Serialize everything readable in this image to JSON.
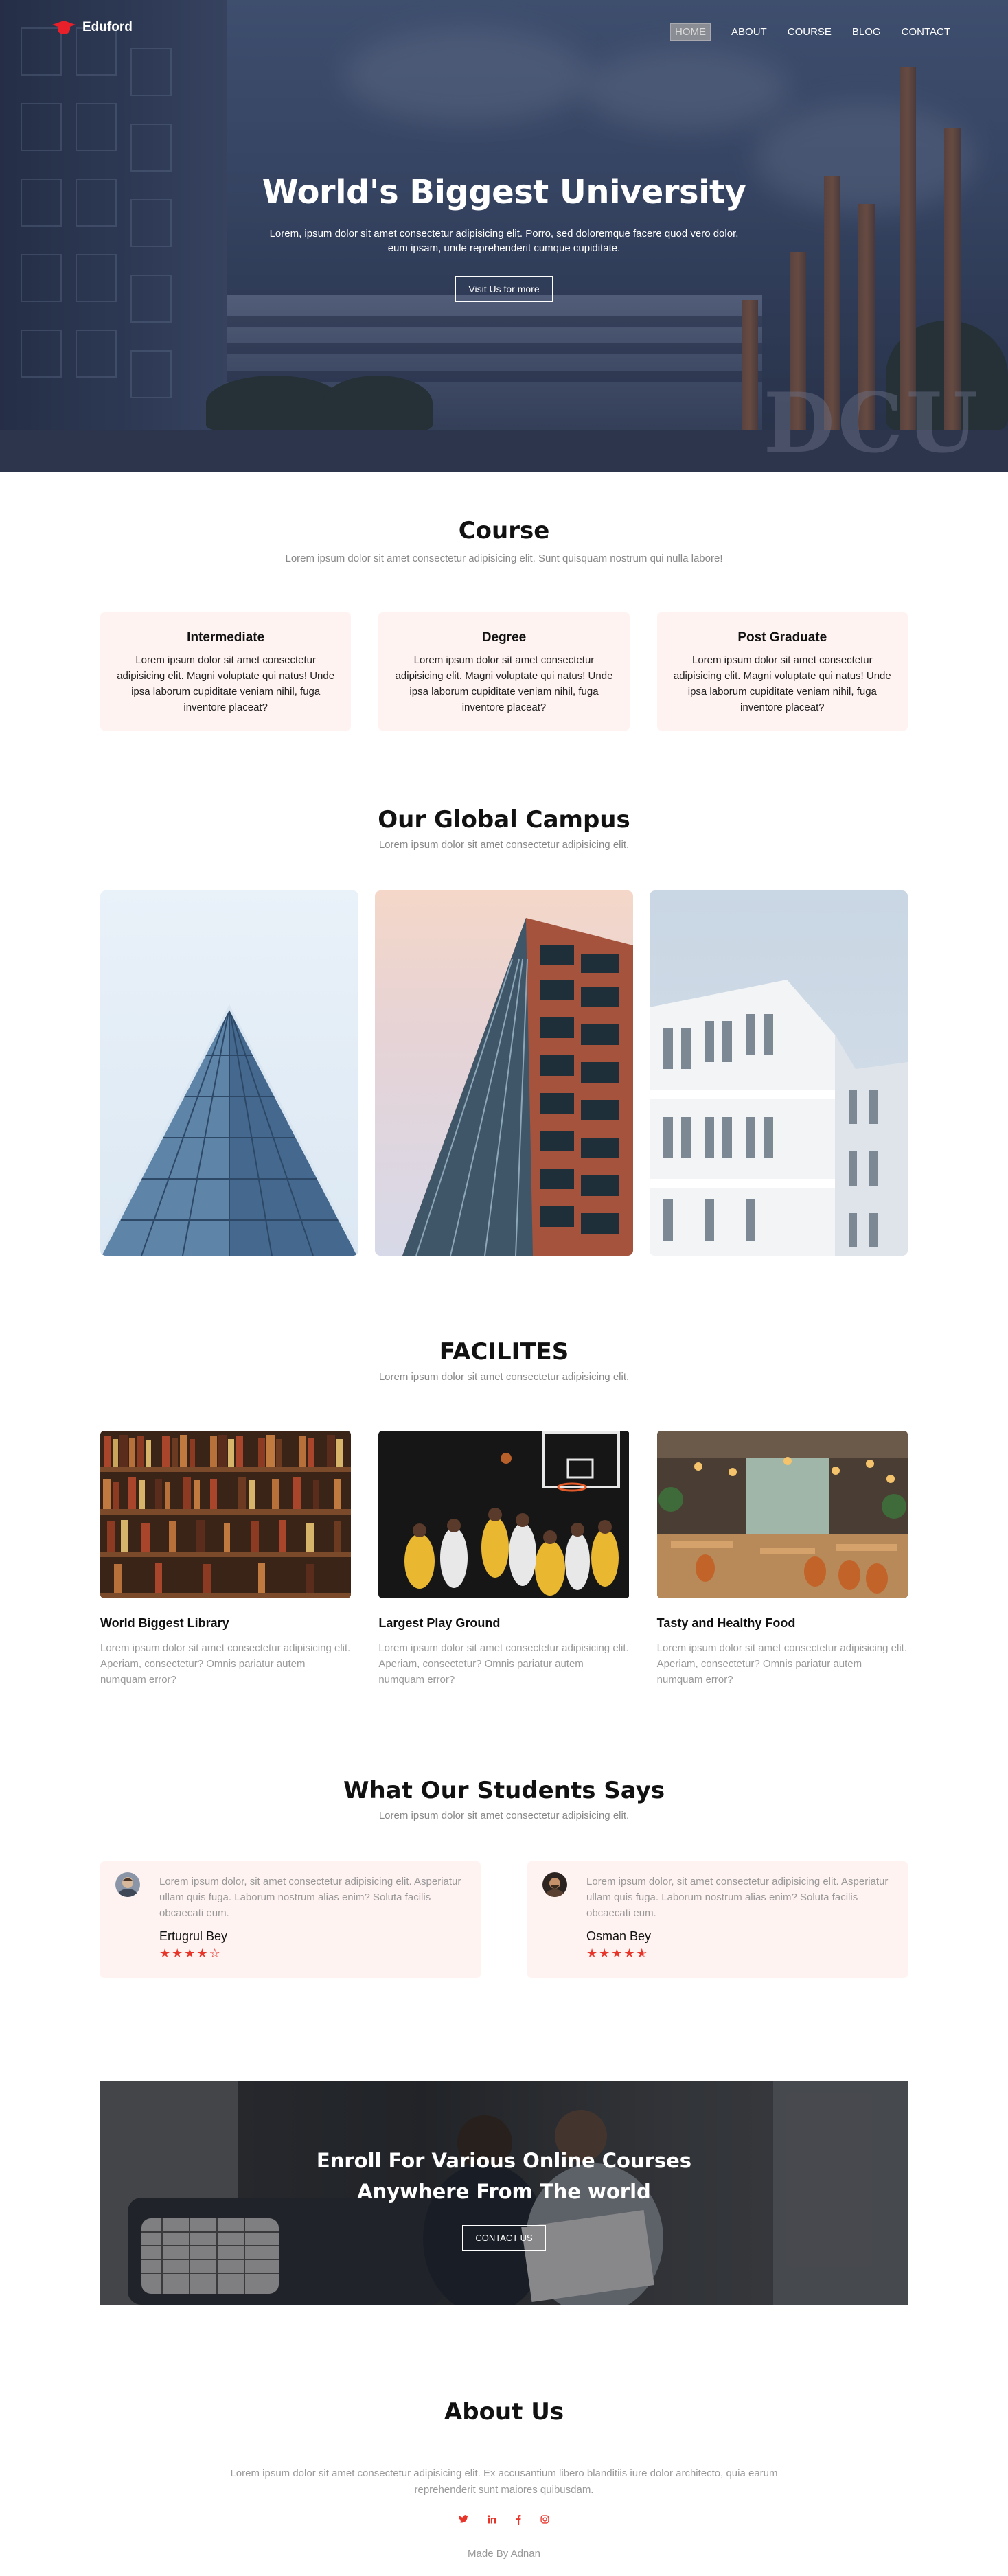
{
  "brand": {
    "name": "Eduford",
    "accent": "#e8202a"
  },
  "nav": {
    "items": [
      {
        "label": "HOME",
        "active": true
      },
      {
        "label": "ABOUT"
      },
      {
        "label": "COURSE"
      },
      {
        "label": "BLOG"
      },
      {
        "label": "CONTACT"
      }
    ]
  },
  "hero": {
    "title": "World's Biggest University",
    "text": "Lorem, ipsum dolor sit amet consectetur adipisicing elit. Porro, sed doloremque facere quod vero dolor, eum ipsam, unde reprehenderit cumque cupiditate.",
    "button": "Visit Us for more",
    "sign": "DCU"
  },
  "course": {
    "title": "Course",
    "subtitle": "Lorem ipsum dolor sit amet consectetur adipisicing elit. Sunt quisquam nostrum qui nulla labore!",
    "cards": [
      {
        "title": "Intermediate",
        "text": "Lorem ipsum dolor sit amet consectetur adipisicing elit. Magni voluptate qui natus! Unde ipsa laborum cupiditate veniam nihil, fuga inventore placeat?"
      },
      {
        "title": "Degree",
        "text": "Lorem ipsum dolor sit amet consectetur adipisicing elit. Magni voluptate qui natus! Unde ipsa laborum cupiditate veniam nihil, fuga inventore placeat?"
      },
      {
        "title": "Post Graduate",
        "text": "Lorem ipsum dolor sit amet consectetur adipisicing elit. Magni voluptate qui natus! Unde ipsa laborum cupiditate veniam nihil, fuga inventore placeat?"
      }
    ]
  },
  "campus": {
    "title": "Our Global Campus",
    "subtitle": "Lorem ipsum dolor sit amet consectetur adipisicing elit."
  },
  "facilities": {
    "title": "FACILITES",
    "subtitle": "Lorem ipsum dolor sit amet consectetur adipisicing elit.",
    "items": [
      {
        "title": "World Biggest Library",
        "text": "Lorem ipsum dolor sit amet consectetur adipisicing elit. Aperiam, consectetur? Omnis pariatur autem numquam error?"
      },
      {
        "title": "Largest Play Ground",
        "text": "Lorem ipsum dolor sit amet consectetur adipisicing elit. Aperiam, consectetur? Omnis pariatur autem numquam error?"
      },
      {
        "title": "Tasty and Healthy Food",
        "text": "Lorem ipsum dolor sit amet consectetur adipisicing elit. Aperiam, consectetur? Omnis pariatur autem numquam error?"
      }
    ]
  },
  "students": {
    "title": "What Our Students Says",
    "subtitle": "Lorem ipsum dolor sit amet consectetur adipisicing elit.",
    "testimonials": [
      {
        "text": "Lorem ipsum dolor, sit amet consectetur adipisicing elit. Asperiatur ullam quis fuga. Laborum nostrum alias enim? Soluta facilis obcaecati eum.",
        "name": "Ertugrul Bey",
        "rating": 4
      },
      {
        "text": "Lorem ipsum dolor, sit amet consectetur adipisicing elit. Asperiatur ullam quis fuga. Laborum nostrum alias enim? Soluta facilis obcaecati eum.",
        "name": "Osman Bey",
        "rating": 4.5
      }
    ]
  },
  "enroll": {
    "line1": "Enroll For Various Online Courses",
    "line2": "Anywhere From The world",
    "button": "CONTACT US"
  },
  "about": {
    "title": "About Us",
    "text": "Lorem ipsum dolor sit amet consectetur adipisicing elit. Ex accusantium libero blanditiis iure dolor architecto, quia earum reprehenderit sunt maiores quibusdam.",
    "social": [
      "twitter-icon",
      "linkedin-icon",
      "facebook-icon",
      "instagram-icon"
    ],
    "made_by": "Made By Adnan"
  }
}
